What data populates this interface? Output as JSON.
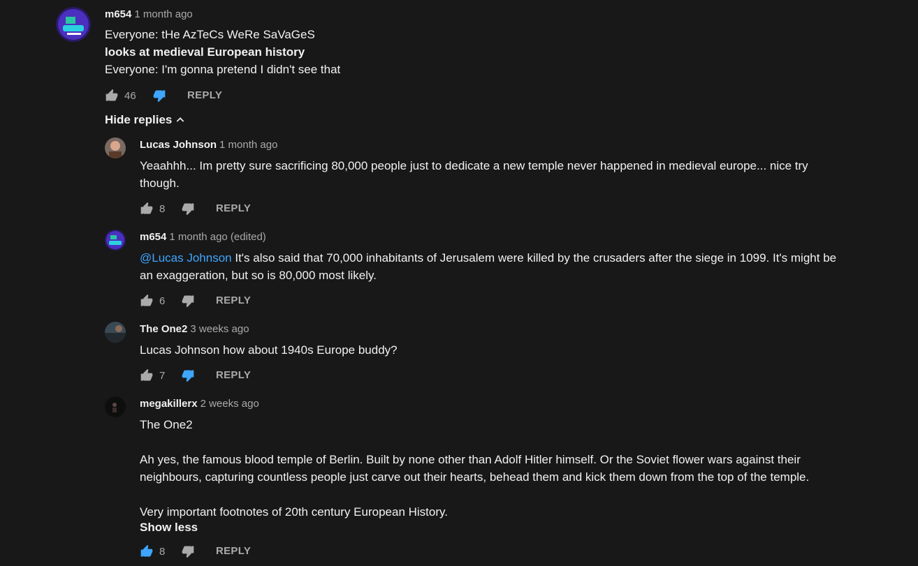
{
  "colors": {
    "background": "#181818",
    "text": "#f1f1f1",
    "muted": "#aaaaaa",
    "accent": "#3ea6ff"
  },
  "comment": {
    "author": "m654",
    "time": "1 month ago",
    "lines": [
      "Everyone: tHe AzTeCs WeRe SaVaGeS",
      "looks at medieval European history",
      "Everyone: I'm gonna pretend I didn't see that"
    ],
    "likes": "46",
    "reply_label": "REPLY",
    "hide_replies_label": "Hide replies",
    "icons": {
      "like": "thumb-up-icon",
      "dislike": "thumb-down-icon-active",
      "collapse": "chevron-up-icon"
    }
  },
  "replies": [
    {
      "author": "Lucas Johnson",
      "time": "1 month ago",
      "lines": [
        "Yeaahhh... Im pretty sure sacrificing 80,000 people just to dedicate a new temple never happened in medieval europe... nice try",
        "though."
      ],
      "likes": "8",
      "reply_label": "REPLY"
    },
    {
      "author": "m654",
      "time": "1 month ago (edited)",
      "mention": "@Lucas Johnson",
      "lines": [
        " It's also said that 70,000 inhabitants of Jerusalem were killed by the crusaders after the siege in 1099. It's might be",
        "an exaggeration, but so is 80,000 most likely."
      ],
      "likes": "6",
      "reply_label": "REPLY"
    },
    {
      "author": "The One2",
      "time": "3 weeks ago",
      "lines": [
        "Lucas Johnson how about 1940s Europe buddy?"
      ],
      "likes": "7",
      "reply_label": "REPLY",
      "disliked": true
    },
    {
      "author": "megakillerx",
      "time": "2 weeks ago",
      "lines": [
        "The One2",
        "Ah yes, the famous blood temple of Berlin. Built by none other than Adolf Hitler himself. Or the Soviet flower wars against their",
        "neighbours, capturing countless people just carve out their hearts, behead them and kick them down from the top of the temple.",
        "Very important footnotes of 20th century European History."
      ],
      "show_less_label": "Show less",
      "likes": "8",
      "reply_label": "REPLY",
      "liked": true
    }
  ]
}
